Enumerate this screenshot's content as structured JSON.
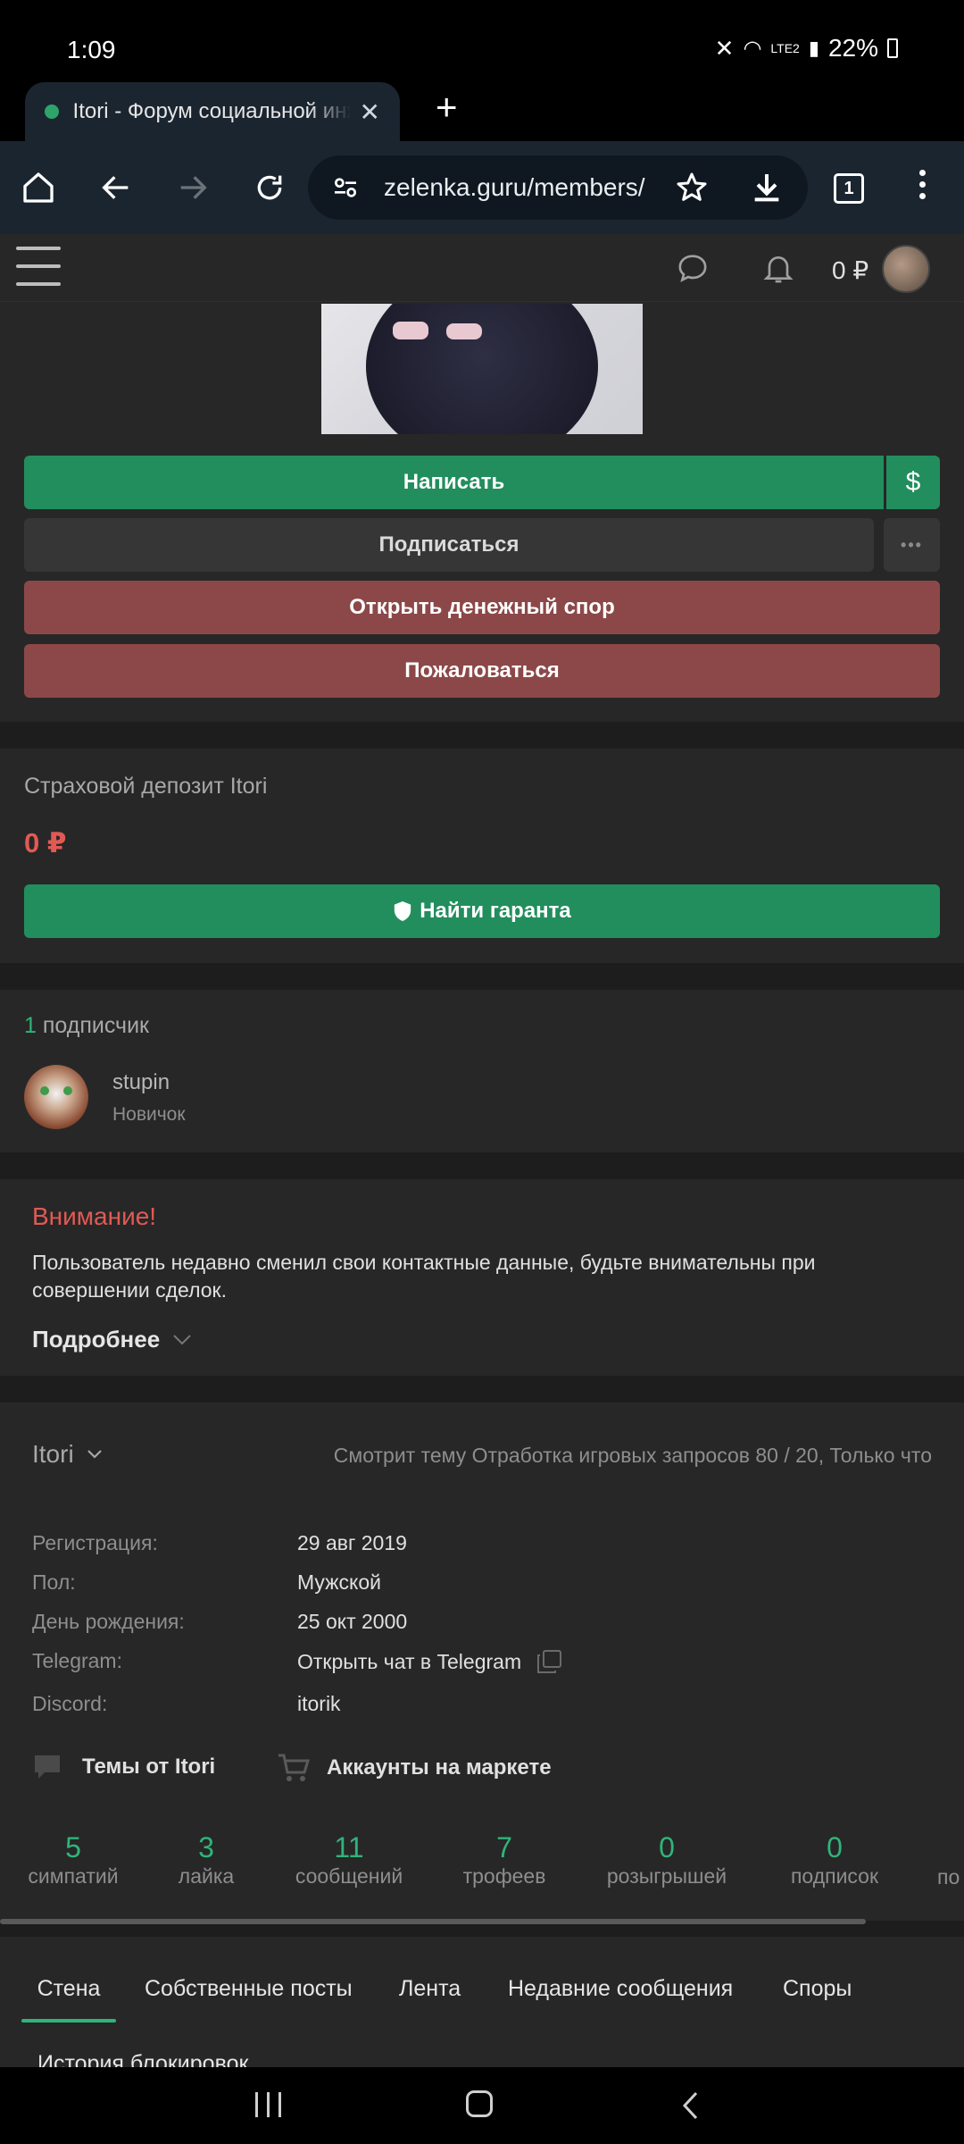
{
  "status_bar": {
    "time": "1:09",
    "network": "LTE2",
    "battery": "22%"
  },
  "browser": {
    "tab_title": "Itori - Форум социальной инженерии",
    "url": "zelenka.guru/members/",
    "tab_count": "1"
  },
  "site_header": {
    "balance": "0 ₽"
  },
  "actions": {
    "write": "Написать",
    "dollar": "$",
    "subscribe": "Подписаться",
    "more": "•••",
    "dispute": "Открыть денежный спор",
    "report": "Пожаловаться"
  },
  "deposit": {
    "title": "Страховой депозит Itori",
    "amount": "0 ₽",
    "find_guarantor": "Найти гаранта"
  },
  "followers": {
    "count": "1",
    "label": "подписчик",
    "user_name": "stupin",
    "user_rank": "Новичок"
  },
  "warning": {
    "title": "Внимание!",
    "text": "Пользователь недавно сменил свои контактные данные, будьте внимательны при совершении сделок.",
    "more": "Подробнее"
  },
  "profile": {
    "username": "Itori",
    "activity": "Смотрит тему Отработка игровых запросов 80 / 20, Только что",
    "fields": [
      {
        "label": "Регистрация:",
        "value": "29 авг 2019"
      },
      {
        "label": "Пол:",
        "value": "Мужской"
      },
      {
        "label": "День рождения:",
        "value": "25 окт 2000"
      },
      {
        "label": "Telegram:",
        "value": "Открыть чат в Telegram"
      },
      {
        "label": "Discord:",
        "value": "itorik"
      }
    ],
    "links": {
      "topics": "Темы от Itori",
      "market": "Аккаунты на маркете"
    }
  },
  "stats": [
    {
      "value": "5",
      "label": "симпатий"
    },
    {
      "value": "3",
      "label": "лайка"
    },
    {
      "value": "11",
      "label": "сообщений"
    },
    {
      "value": "7",
      "label": "трофеев"
    },
    {
      "value": "0",
      "label": "розыгрышей"
    },
    {
      "value": "0",
      "label": "подписок"
    },
    {
      "value": "",
      "label": "по"
    }
  ],
  "profile_tabs": [
    "Стена",
    "Собственные посты",
    "Лента",
    "Недавние сообщения",
    "Споры"
  ],
  "profile_tab_more": "История блокировок",
  "colors": {
    "accent_green": "#228e5d",
    "danger_red": "#8c4848",
    "warning_text": "#e05a55",
    "stat_green": "#2fb47a"
  }
}
